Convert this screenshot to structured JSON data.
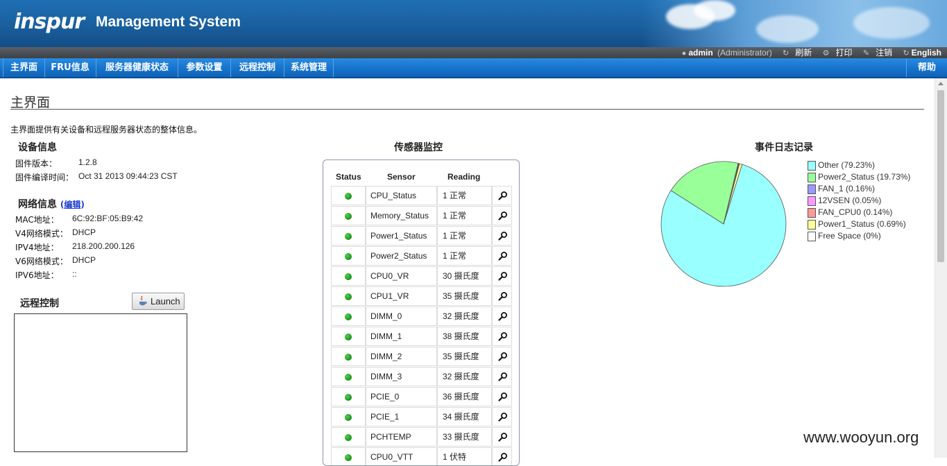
{
  "header": {
    "logo": "inspur",
    "app_title": "Management System"
  },
  "userbar": {
    "user": "admin",
    "role": "(Administrator)",
    "refresh": "刷新",
    "print": "打印",
    "logout": "注销",
    "language": "English"
  },
  "nav": {
    "items": [
      {
        "label": "主界面"
      },
      {
        "label": "FRU信息"
      },
      {
        "label": "服务器健康状态"
      },
      {
        "label": "参数设置"
      },
      {
        "label": "远程控制"
      },
      {
        "label": "系统管理"
      }
    ],
    "help": "帮助"
  },
  "page": {
    "title": "主界面",
    "description": "主界面提供有关设备和远程服务器状态的整体信息。"
  },
  "device": {
    "heading": "设备信息",
    "fw_version_label": "固件版本：",
    "fw_version": "1.2.8",
    "fw_build_label": "固件编译时间：",
    "fw_build": "Oct 31 2013 09:44:23 CST"
  },
  "network": {
    "heading": "网络信息",
    "edit_open": "(",
    "edit_label": "编辑",
    "edit_close": ")",
    "mac_label": "MAC地址：",
    "mac": "6C:92:BF:05:B9:42",
    "v4mode_label": "V4网络模式：",
    "v4mode": "DHCP",
    "ipv4_label": "IPV4地址：",
    "ipv4": "218.200.200.126",
    "v6mode_label": "V6网络模式：",
    "v6mode": "DHCP",
    "ipv6_label": "IPV6地址：",
    "ipv6": "::"
  },
  "remote": {
    "heading": "远程控制",
    "launch": "Launch"
  },
  "sensors": {
    "heading": "传感器监控",
    "columns": {
      "status": "Status",
      "sensor": "Sensor",
      "reading": "Reading"
    },
    "status_color": "#2aa52a",
    "rows": [
      {
        "sensor": "CPU_Status",
        "reading": "1 正常"
      },
      {
        "sensor": "Memory_Status",
        "reading": "1 正常"
      },
      {
        "sensor": "Power1_Status",
        "reading": "1 正常"
      },
      {
        "sensor": "Power2_Status",
        "reading": "1 正常"
      },
      {
        "sensor": "CPU0_VR",
        "reading": "30 摄氏度"
      },
      {
        "sensor": "CPU1_VR",
        "reading": "35 摄氏度"
      },
      {
        "sensor": "DIMM_0",
        "reading": "32 摄氏度"
      },
      {
        "sensor": "DIMM_1",
        "reading": "38 摄氏度"
      },
      {
        "sensor": "DIMM_2",
        "reading": "35 摄氏度"
      },
      {
        "sensor": "DIMM_3",
        "reading": "32 摄氏度"
      },
      {
        "sensor": "PCIE_0",
        "reading": "36 摄氏度"
      },
      {
        "sensor": "PCIE_1",
        "reading": "34 摄氏度"
      },
      {
        "sensor": "PCHTEMP",
        "reading": "33 摄氏度"
      },
      {
        "sensor": "CPU0_VTT",
        "reading": "1 伏特"
      }
    ]
  },
  "event_log": {
    "heading": "事件日志记录"
  },
  "chart_data": {
    "type": "pie",
    "title": "事件日志记录",
    "slices": [
      {
        "label": "Other (79.23%)",
        "value": 79.23,
        "color": "#99ffff"
      },
      {
        "label": "Power2_Status (19.73%)",
        "value": 19.73,
        "color": "#99ff99"
      },
      {
        "label": "FAN_1 (0.16%)",
        "value": 0.16,
        "color": "#9999ff"
      },
      {
        "label": "12VSEN (0.05%)",
        "value": 0.05,
        "color": "#ff99ff"
      },
      {
        "label": "FAN_CPU0 (0.14%)",
        "value": 0.14,
        "color": "#ff9999"
      },
      {
        "label": "Power1_Status (0.69%)",
        "value": 0.69,
        "color": "#ffff99"
      },
      {
        "label": "Free Space (0%)",
        "value": 0,
        "color": "#ffffff"
      }
    ],
    "legend_position": "right"
  },
  "watermark": "www.wooyun.org"
}
